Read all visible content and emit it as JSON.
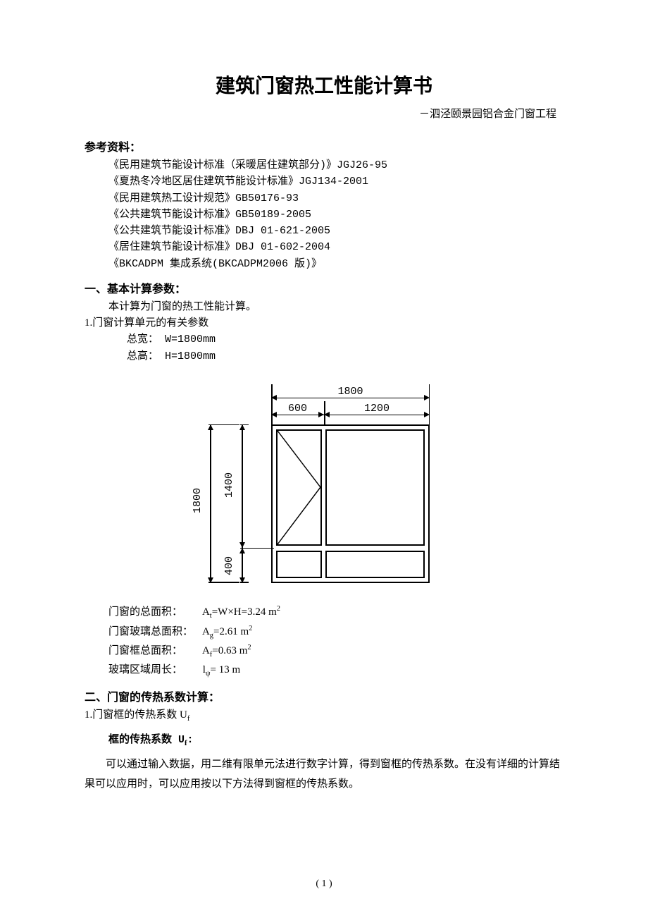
{
  "title": "建筑门窗热工性能计算书",
  "subtitle": "－泗泾颐景园铝合金门窗工程",
  "references": {
    "heading": "参考资料：",
    "items": [
      "《民用建筑节能设计标准（采暖居住建筑部分)》JGJ26-95",
      "《夏热冬冷地区居住建筑节能设计标准》JGJ134-2001",
      "《民用建筑热工设计规范》GB50176-93",
      "《公共建筑节能设计标准》GB50189-2005",
      "《公共建筑节能设计标准》DBJ 01-621-2005",
      "《居住建筑节能设计标准》DBJ 01-602-2004",
      "《BKCADPM 集成系统(BKCADPM2006 版)》"
    ]
  },
  "section1": {
    "heading": "一、基本计算参数：",
    "intro": "本计算为门窗的热工性能计算。",
    "item1": "1.门窗计算单元的有关参数",
    "width_line": "总宽：  W=1800mm",
    "height_line": "总高：  H=1800mm"
  },
  "figure": {
    "dim_total_w": "1800",
    "dim_left_w": "600",
    "dim_right_w": "1200",
    "dim_total_h": "1800",
    "dim_upper_h": "1400",
    "dim_lower_h": "400"
  },
  "areas": {
    "total_label": "门窗的总面积：",
    "total_value_prefix": "A",
    "total_value_sub": "t",
    "total_value": "=W×H=3.24  m",
    "glass_label": "门窗玻璃总面积：",
    "glass_value_prefix": "A",
    "glass_value_sub": "g",
    "glass_value": "=2.61  m",
    "frame_label": "门窗框总面积：",
    "frame_value_prefix": "A",
    "frame_value_sub": "f",
    "frame_value": "=0.63  m",
    "perim_label": "玻璃区域周长：",
    "perim_value_prefix": "l",
    "perim_value_sub": "ψ",
    "perim_value": "=  13  m"
  },
  "section2": {
    "heading": "二、门窗的传热系数计算：",
    "item1_prefix": "1.门窗框的传热系数 U",
    "item1_sub": "f",
    "sub_heading_prefix": "框的传热系数 U",
    "sub_heading_sub": "f",
    "sub_heading_suffix": ":",
    "para": "可以通过输入数据，用二维有限单元法进行数字计算，得到窗框的传热系数。在没有详细的计算结果可以应用时，可以应用按以下方法得到窗框的传热系数。"
  },
  "pagenum": "( 1 )"
}
